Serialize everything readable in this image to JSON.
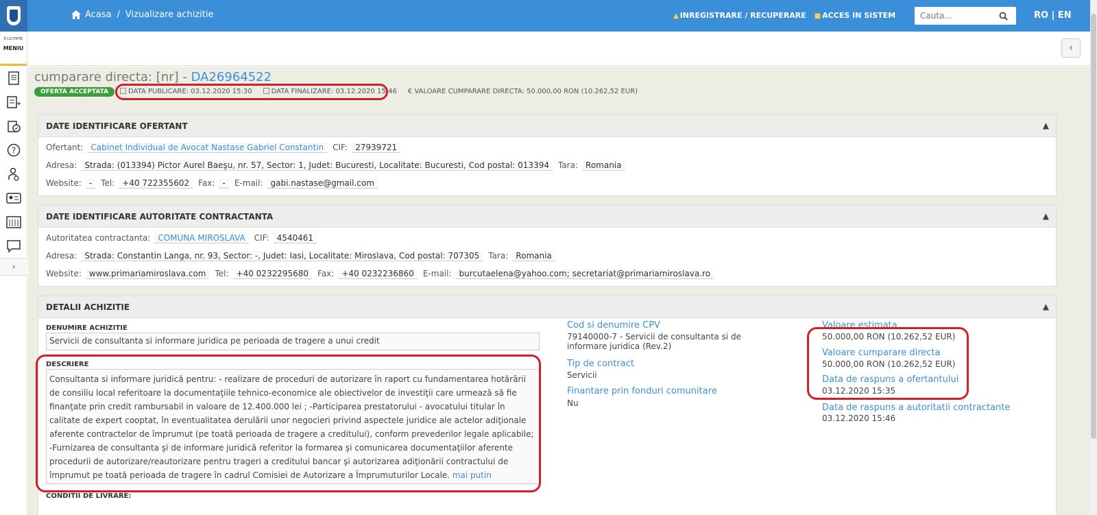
{
  "header": {
    "breadcrumb_home": "Acasa",
    "breadcrumb_sep": "/",
    "breadcrumb_current": "Vizualizare achizitie",
    "link_register": "INREGISTRARE / RECUPERARE",
    "link_login": "ACCES IN SISTEM",
    "search_placeholder": "Cauta...",
    "lang_ro": "RO",
    "lang_sep": "|",
    "lang_en": "EN"
  },
  "sidebar": {
    "brand_small": "E-LICITATIE",
    "menu_label": "MENIU",
    "icons": [
      "document-icon",
      "list-arrow-icon",
      "clipboard-check-icon",
      "help-icon",
      "user-gear-icon",
      "id-card-icon",
      "library-icon",
      "chat-icon"
    ]
  },
  "page": {
    "title_prefix": "cumparare directa: [nr] - ",
    "title_code": "DA26964522",
    "status_badge": "OFERTA ACCEPTATA",
    "publish_date": "DATA PUBLICARE: 03.12.2020 15:30",
    "final_date": "DATA FINALIZARE: 03.12.2020 15:46",
    "value": "€ VALOARE CUMPARARE DIRECTA: 50.000,00  RON (10.262,52  EUR)"
  },
  "ofertant": {
    "title": "DATE IDENTIFICARE OFERTANT",
    "label_ofertant": "Ofertant:",
    "name": "Cabinet Individual de Avocat Nastase Gabriel Constantin",
    "label_cif": "CIF:",
    "cif": "27939721",
    "label_adresa": "Adresa:",
    "adresa": "Strada: (013394) Pictor Aurel Baeşu, nr. 57, Sector: 1, Judet: Bucuresti, Localitate: Bucuresti, Cod postal: 013394",
    "label_tara": "Tara:",
    "tara": "Romania",
    "label_website": "Website:",
    "website": "-",
    "label_tel": "Tel:",
    "tel": "+40 722355602",
    "label_fax": "Fax:",
    "fax": "-",
    "label_email": "E-mail:",
    "email": "gabi.nastase@gmail.com"
  },
  "autoritate": {
    "title": "DATE IDENTIFICARE AUTORITATE CONTRACTANTA",
    "label_autoritate": "Autoritatea contractanta:",
    "name": "COMUNA MIROSLAVA",
    "label_cif": "CIF:",
    "cif": "4540461",
    "label_adresa": "Adresa:",
    "adresa": "Strada: Constantin Langa, nr. 93, Sector: -, Judet: Iasi, Localitate: Miroslava, Cod postal: 707305",
    "label_tara": "Tara:",
    "tara": "Romania",
    "label_website": "Website:",
    "website": "www.primariamiroslava.com",
    "label_tel": "Tel:",
    "tel": "+40 0232295680",
    "label_fax": "Fax:",
    "fax": "+40 0232236860",
    "label_email": "E-mail:",
    "email": "burcutaelena@yahoo.com; secretariat@primariamiroslava.ro"
  },
  "detalii": {
    "title": "DETALII ACHIZITIE",
    "label_denumire": "DENUMIRE ACHIZITIE",
    "denumire": "Servicii de consultanta si informare juridica pe perioada de tragere a unui credit",
    "label_descriere": "DESCRIERE",
    "descriere": "Consultanta si informare juridică pentru: - realizare de proceduri de autorizare în raport cu fundamentarea hotărârii de consiliu local referitoare la documentaţiile tehnico-economice ale obiectivelor de investiţii care urmează să fie finanţate prin credit rambursabil in valoare de 12.400.000 lei ; -Participarea prestatorului - avocatului titular în calitate de expert cooptat, în eventualitatea derulării unor negocieri privind aspectele juridice ale actelor adiţionale aferente contractelor de împrumut (pe toată perioada de tragere a creditului), conform prevederilor legale aplicabile; -Furnizarea de consultanta şi de informare juridică referitor la formarea şi comunicarea documentaţiilor aferente procedurii de autorizare/reautorizare pentru trageri a creditului bancar şi autorizarea adiţionării contractului de împrumut pe toată perioada de tragere în cadrul Comisiei de Autorizare a Împrumuturilor Locale.",
    "more_link": "mai putin",
    "label_conditii": "CONDITII DE LIVRARE:",
    "label_cpv": "Cod si denumire CPV",
    "cpv": "79140000-7 - Servicii de consultanta si de informare juridica (Rev.2)",
    "label_tip": "Tip de contract",
    "tip": "Servicii",
    "label_fonduri": "Finantare prin fonduri comunitare",
    "fonduri": "Nu",
    "label_val_est": "Valoare estimata",
    "val_est": "50.000,00  RON (10.262,52  EUR)",
    "label_val_cump": "Valoare cumparare directa",
    "val_cump": "50.000,00  RON (10.262,52  EUR)",
    "label_data_ofert": "Data de raspuns a ofertantului",
    "data_ofert": "03.12.2020 15:35",
    "label_data_aut": "Data de raspuns a autoritatii contractante",
    "data_aut": "03.12.2020 15:46"
  },
  "colors": {
    "topbar": "#3b8ed8",
    "link": "#3b8ed8",
    "badge": "#3a9f3a",
    "highlight": "#d11f2a"
  }
}
